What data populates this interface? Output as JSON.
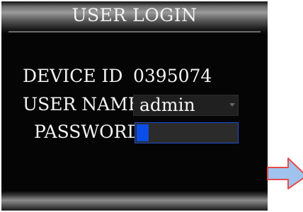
{
  "dialog": {
    "title": "USER LOGIN",
    "device_id_label": "DEVICE ID",
    "device_id_value": "0395074",
    "user_name_label": "USER NAME",
    "user_name_value": "admin",
    "password_label": "PASSWORD"
  },
  "icons": {
    "dropdown": "chevron-down-icon",
    "arrow": "arrow-icon"
  },
  "colors": {
    "background": "#050505",
    "text": "#f4f4f4",
    "focus_border": "#1f4fd0",
    "cursor": "#0a4de8",
    "arrow_fill": "#9fc3ec",
    "arrow_outline": "#e44c4c"
  }
}
